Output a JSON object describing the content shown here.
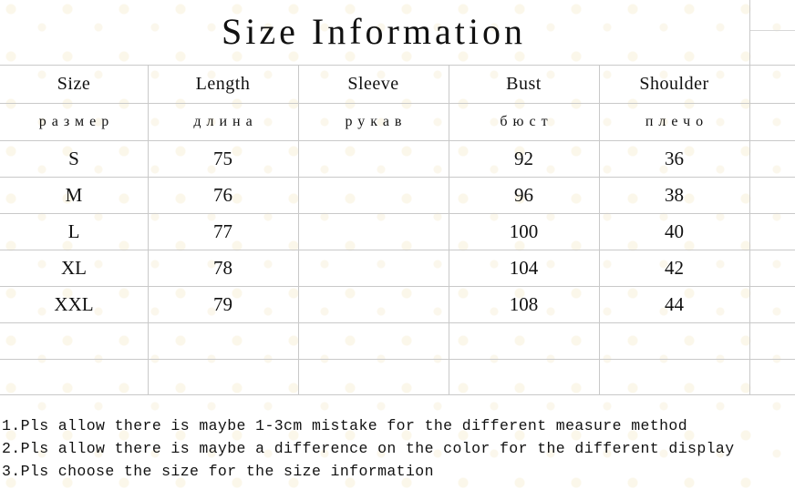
{
  "title": "Size Information",
  "table": {
    "columns_en": [
      "Size",
      "Length",
      "Sleeve",
      "Bust",
      "Shoulder"
    ],
    "columns_ru": [
      "размер",
      "длина",
      "рукав",
      "бюст",
      "плечо"
    ],
    "rows": [
      {
        "size": "S",
        "length": "75",
        "sleeve": "",
        "bust": "92",
        "shoulder": "36"
      },
      {
        "size": "M",
        "length": "76",
        "sleeve": "",
        "bust": "96",
        "shoulder": "38"
      },
      {
        "size": "L",
        "length": "77",
        "sleeve": "",
        "bust": "100",
        "shoulder": "40"
      },
      {
        "size": "XL",
        "length": "78",
        "sleeve": "",
        "bust": "104",
        "shoulder": "42"
      },
      {
        "size": "XXL",
        "length": "79",
        "sleeve": "",
        "bust": "108",
        "shoulder": "44"
      },
      {
        "size": "",
        "length": "",
        "sleeve": "",
        "bust": "",
        "shoulder": ""
      },
      {
        "size": "",
        "length": "",
        "sleeve": "",
        "bust": "",
        "shoulder": ""
      }
    ]
  },
  "notes": [
    "1.Pls allow there is maybe 1-3cm mistake for the different measure method",
    "2.Pls allow there is maybe a difference on the color for the different display",
    "3.Pls choose the size for the size information"
  ],
  "colors": {
    "grid_line": "#c9c9c9",
    "text": "#111111",
    "background": "#ffffff"
  }
}
